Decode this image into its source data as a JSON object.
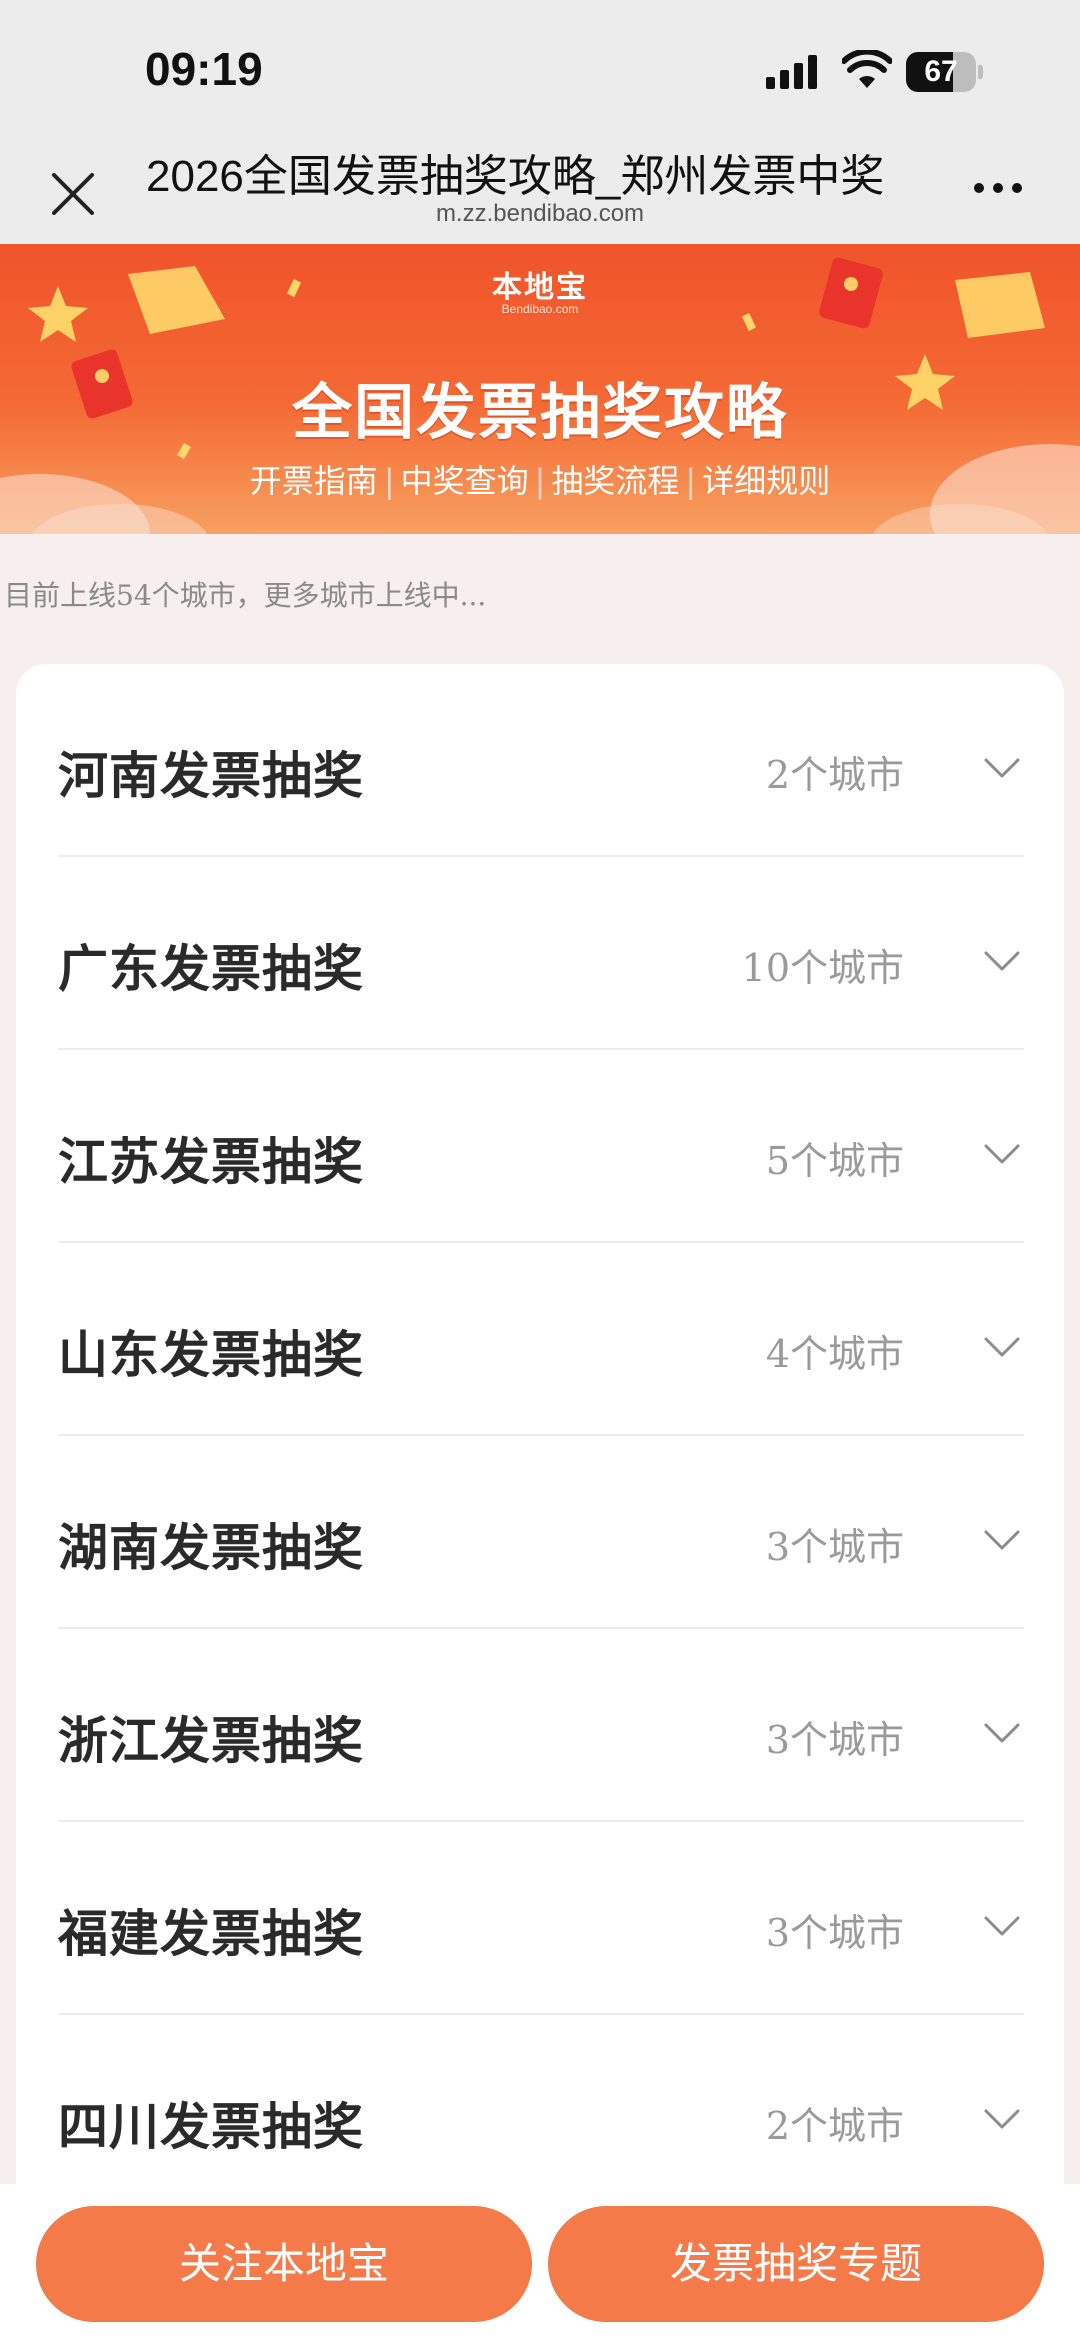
{
  "status_bar": {
    "time": "09:19",
    "battery": "67",
    "battery_level": 0.67,
    "icons": [
      "signal-icon",
      "wifi-icon",
      "battery-icon"
    ]
  },
  "nav": {
    "title": "2026全国发票抽奖攻略_郑州发票中奖",
    "url": "m.zz.bendibao.com",
    "close_icon": "close-icon",
    "more_icon": "more-icon"
  },
  "banner": {
    "logo": "本地宝",
    "logo_sub": "Bendibao.com",
    "title": "全国发票抽奖攻略",
    "links": [
      "开票指南",
      "中奖查询",
      "抽奖流程",
      "详细规则"
    ],
    "separator": "|"
  },
  "notice": "目前上线54个城市，更多城市上线中...",
  "provinces": [
    {
      "name": "河南发票抽奖",
      "count": "2个城市"
    },
    {
      "name": "广东发票抽奖",
      "count": "10个城市"
    },
    {
      "name": "江苏发票抽奖",
      "count": "5个城市"
    },
    {
      "name": "山东发票抽奖",
      "count": "4个城市"
    },
    {
      "name": "湖南发票抽奖",
      "count": "3个城市"
    },
    {
      "name": "浙江发票抽奖",
      "count": "3个城市"
    },
    {
      "name": "福建发票抽奖",
      "count": "3个城市"
    },
    {
      "name": "四川发票抽奖",
      "count": "2个城市"
    }
  ],
  "bottom_bar": {
    "follow_label": "关注本地宝",
    "topic_label": "发票抽奖专题"
  },
  "colors": {
    "banner_red": "#f0532a",
    "button_orange": "#f47a4a",
    "content_bg": "#f7eeee"
  }
}
